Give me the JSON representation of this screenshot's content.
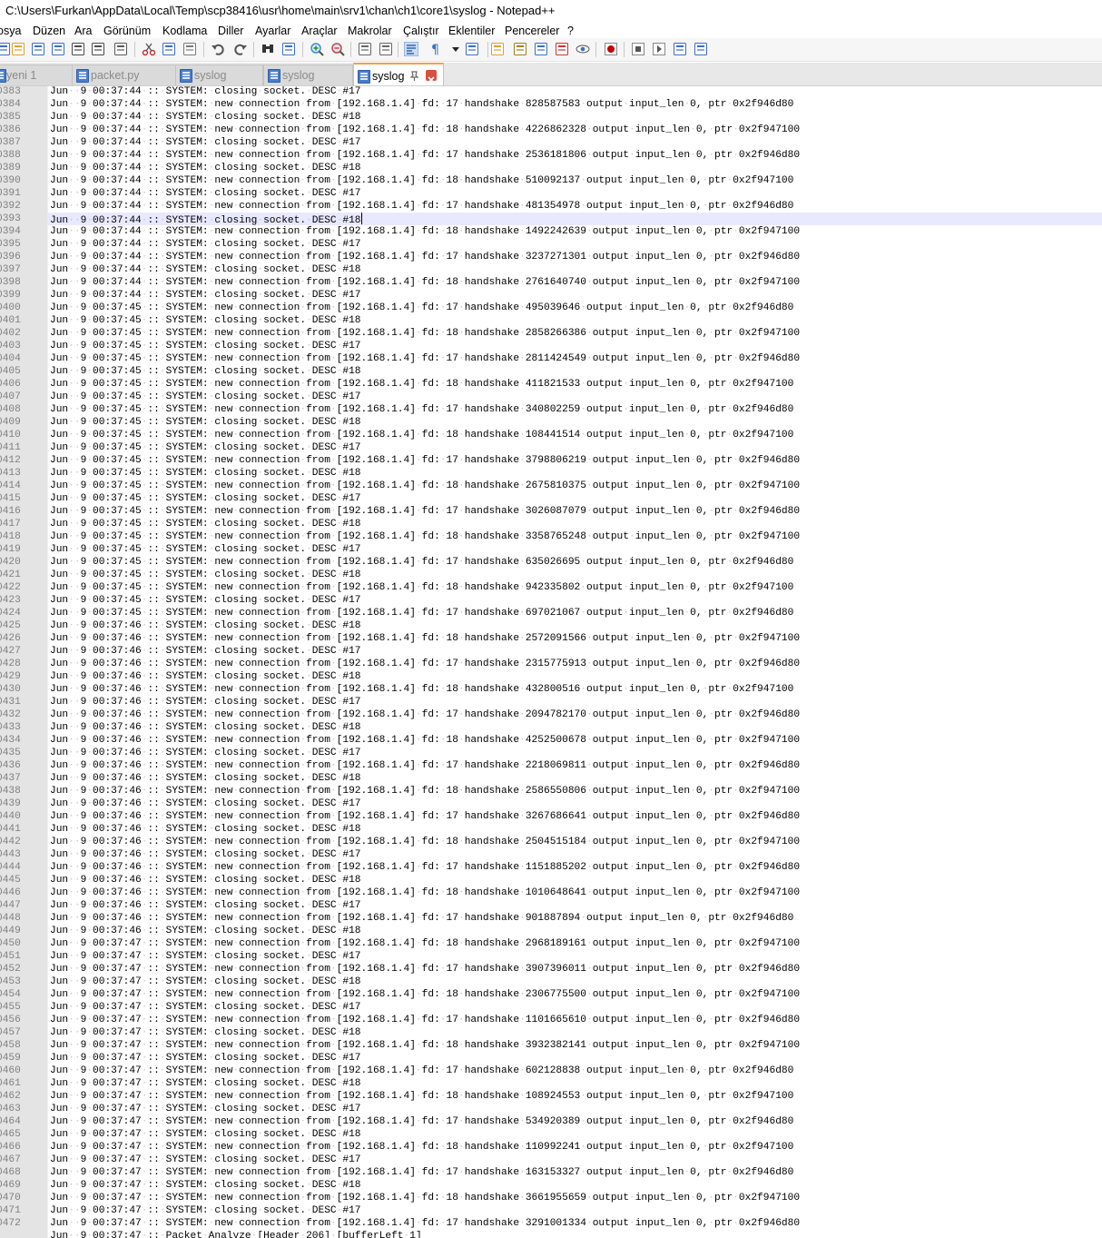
{
  "window": {
    "title": "C:\\Users\\Furkan\\AppData\\Local\\Temp\\scp38416\\usr\\home\\main\\srv1\\chan\\ch1\\core1\\syslog - Notepad++"
  },
  "menu": [
    "osya",
    "Düzen",
    "Ara",
    "Görünüm",
    "Kodlama",
    "Diller",
    "Ayarlar",
    "Araçlar",
    "Makrolar",
    "Çalıştır",
    "Eklentiler",
    "Pencereler",
    "?"
  ],
  "tabs": [
    {
      "label": "yeni 1",
      "active": false
    },
    {
      "label": "packet.py",
      "active": false
    },
    {
      "label": "syslog",
      "active": false
    },
    {
      "label": "syslog",
      "active": false
    },
    {
      "label": "syslog",
      "active": true
    }
  ],
  "editor": {
    "current_line": 393,
    "last_partial_line": "Jun  9 00:37:47 :: Packet Analyze [Header 206] [bufferLeft 1]",
    "lines": [
      {
        "n": "0383",
        "t": "Jun  9 00:37:44 :: SYSTEM: closing socket. DESC #17"
      },
      {
        "n": "0384",
        "t": "Jun  9 00:37:44 :: SYSTEM: new connection from [192.168.1.4] fd: 17 handshake 828587583 output input_len 0, ptr 0x2f946d80"
      },
      {
        "n": "0385",
        "t": "Jun  9 00:37:44 :: SYSTEM: closing socket. DESC #18"
      },
      {
        "n": "0386",
        "t": "Jun  9 00:37:44 :: SYSTEM: new connection from [192.168.1.4] fd: 18 handshake 4226862328 output input_len 0, ptr 0x2f947100"
      },
      {
        "n": "0387",
        "t": "Jun  9 00:37:44 :: SYSTEM: closing socket. DESC #17"
      },
      {
        "n": "0388",
        "t": "Jun  9 00:37:44 :: SYSTEM: new connection from [192.168.1.4] fd: 17 handshake 2536181806 output input_len 0, ptr 0x2f946d80"
      },
      {
        "n": "0389",
        "t": "Jun  9 00:37:44 :: SYSTEM: closing socket. DESC #18"
      },
      {
        "n": "0390",
        "t": "Jun  9 00:37:44 :: SYSTEM: new connection from [192.168.1.4] fd: 18 handshake 510092137 output input_len 0, ptr 0x2f947100"
      },
      {
        "n": "0391",
        "t": "Jun  9 00:37:44 :: SYSTEM: closing socket. DESC #17"
      },
      {
        "n": "0392",
        "t": "Jun  9 00:37:44 :: SYSTEM: new connection from [192.168.1.4] fd: 17 handshake 481354978 output input_len 0, ptr 0x2f946d80"
      },
      {
        "n": "0393",
        "t": "Jun  9 00:37:44 :: SYSTEM: closing socket. DESC #18"
      },
      {
        "n": "0394",
        "t": "Jun  9 00:37:44 :: SYSTEM: new connection from [192.168.1.4] fd: 18 handshake 1492242639 output input_len 0, ptr 0x2f947100"
      },
      {
        "n": "0395",
        "t": "Jun  9 00:37:44 :: SYSTEM: closing socket. DESC #17"
      },
      {
        "n": "0396",
        "t": "Jun  9 00:37:44 :: SYSTEM: new connection from [192.168.1.4] fd: 17 handshake 3237271301 output input_len 0, ptr 0x2f946d80"
      },
      {
        "n": "0397",
        "t": "Jun  9 00:37:44 :: SYSTEM: closing socket. DESC #18"
      },
      {
        "n": "0398",
        "t": "Jun  9 00:37:44 :: SYSTEM: new connection from [192.168.1.4] fd: 18 handshake 2761640740 output input_len 0, ptr 0x2f947100"
      },
      {
        "n": "0399",
        "t": "Jun  9 00:37:44 :: SYSTEM: closing socket. DESC #17"
      },
      {
        "n": "0400",
        "t": "Jun  9 00:37:45 :: SYSTEM: new connection from [192.168.1.4] fd: 17 handshake 495039646 output input_len 0, ptr 0x2f946d80"
      },
      {
        "n": "0401",
        "t": "Jun  9 00:37:45 :: SYSTEM: closing socket. DESC #18"
      },
      {
        "n": "0402",
        "t": "Jun  9 00:37:45 :: SYSTEM: new connection from [192.168.1.4] fd: 18 handshake 2858266386 output input_len 0, ptr 0x2f947100"
      },
      {
        "n": "0403",
        "t": "Jun  9 00:37:45 :: SYSTEM: closing socket. DESC #17"
      },
      {
        "n": "0404",
        "t": "Jun  9 00:37:45 :: SYSTEM: new connection from [192.168.1.4] fd: 17 handshake 2811424549 output input_len 0, ptr 0x2f946d80"
      },
      {
        "n": "0405",
        "t": "Jun  9 00:37:45 :: SYSTEM: closing socket. DESC #18"
      },
      {
        "n": "0406",
        "t": "Jun  9 00:37:45 :: SYSTEM: new connection from [192.168.1.4] fd: 18 handshake 411821533 output input_len 0, ptr 0x2f947100"
      },
      {
        "n": "0407",
        "t": "Jun  9 00:37:45 :: SYSTEM: closing socket. DESC #17"
      },
      {
        "n": "0408",
        "t": "Jun  9 00:37:45 :: SYSTEM: new connection from [192.168.1.4] fd: 17 handshake 340802259 output input_len 0, ptr 0x2f946d80"
      },
      {
        "n": "0409",
        "t": "Jun  9 00:37:45 :: SYSTEM: closing socket. DESC #18"
      },
      {
        "n": "0410",
        "t": "Jun  9 00:37:45 :: SYSTEM: new connection from [192.168.1.4] fd: 18 handshake 108441514 output input_len 0, ptr 0x2f947100"
      },
      {
        "n": "0411",
        "t": "Jun  9 00:37:45 :: SYSTEM: closing socket. DESC #17"
      },
      {
        "n": "0412",
        "t": "Jun  9 00:37:45 :: SYSTEM: new connection from [192.168.1.4] fd: 17 handshake 3798806219 output input_len 0, ptr 0x2f946d80"
      },
      {
        "n": "0413",
        "t": "Jun  9 00:37:45 :: SYSTEM: closing socket. DESC #18"
      },
      {
        "n": "0414",
        "t": "Jun  9 00:37:45 :: SYSTEM: new connection from [192.168.1.4] fd: 18 handshake 2675810375 output input_len 0, ptr 0x2f947100"
      },
      {
        "n": "0415",
        "t": "Jun  9 00:37:45 :: SYSTEM: closing socket. DESC #17"
      },
      {
        "n": "0416",
        "t": "Jun  9 00:37:45 :: SYSTEM: new connection from [192.168.1.4] fd: 17 handshake 3026087079 output input_len 0, ptr 0x2f946d80"
      },
      {
        "n": "0417",
        "t": "Jun  9 00:37:45 :: SYSTEM: closing socket. DESC #18"
      },
      {
        "n": "0418",
        "t": "Jun  9 00:37:45 :: SYSTEM: new connection from [192.168.1.4] fd: 18 handshake 3358765248 output input_len 0, ptr 0x2f947100"
      },
      {
        "n": "0419",
        "t": "Jun  9 00:37:45 :: SYSTEM: closing socket. DESC #17"
      },
      {
        "n": "0420",
        "t": "Jun  9 00:37:45 :: SYSTEM: new connection from [192.168.1.4] fd: 17 handshake 635026695 output input_len 0, ptr 0x2f946d80"
      },
      {
        "n": "0421",
        "t": "Jun  9 00:37:45 :: SYSTEM: closing socket. DESC #18"
      },
      {
        "n": "0422",
        "t": "Jun  9 00:37:45 :: SYSTEM: new connection from [192.168.1.4] fd: 18 handshake 942335802 output input_len 0, ptr 0x2f947100"
      },
      {
        "n": "0423",
        "t": "Jun  9 00:37:45 :: SYSTEM: closing socket. DESC #17"
      },
      {
        "n": "0424",
        "t": "Jun  9 00:37:45 :: SYSTEM: new connection from [192.168.1.4] fd: 17 handshake 697021067 output input_len 0, ptr 0x2f946d80"
      },
      {
        "n": "0425",
        "t": "Jun  9 00:37:46 :: SYSTEM: closing socket. DESC #18"
      },
      {
        "n": "0426",
        "t": "Jun  9 00:37:46 :: SYSTEM: new connection from [192.168.1.4] fd: 18 handshake 2572091566 output input_len 0, ptr 0x2f947100"
      },
      {
        "n": "0427",
        "t": "Jun  9 00:37:46 :: SYSTEM: closing socket. DESC #17"
      },
      {
        "n": "0428",
        "t": "Jun  9 00:37:46 :: SYSTEM: new connection from [192.168.1.4] fd: 17 handshake 2315775913 output input_len 0, ptr 0x2f946d80"
      },
      {
        "n": "0429",
        "t": "Jun  9 00:37:46 :: SYSTEM: closing socket. DESC #18"
      },
      {
        "n": "0430",
        "t": "Jun  9 00:37:46 :: SYSTEM: new connection from [192.168.1.4] fd: 18 handshake 432800516 output input_len 0, ptr 0x2f947100"
      },
      {
        "n": "0431",
        "t": "Jun  9 00:37:46 :: SYSTEM: closing socket. DESC #17"
      },
      {
        "n": "0432",
        "t": "Jun  9 00:37:46 :: SYSTEM: new connection from [192.168.1.4] fd: 17 handshake 2094782170 output input_len 0, ptr 0x2f946d80"
      },
      {
        "n": "0433",
        "t": "Jun  9 00:37:46 :: SYSTEM: closing socket. DESC #18"
      },
      {
        "n": "0434",
        "t": "Jun  9 00:37:46 :: SYSTEM: new connection from [192.168.1.4] fd: 18 handshake 4252500678 output input_len 0, ptr 0x2f947100"
      },
      {
        "n": "0435",
        "t": "Jun  9 00:37:46 :: SYSTEM: closing socket. DESC #17"
      },
      {
        "n": "0436",
        "t": "Jun  9 00:37:46 :: SYSTEM: new connection from [192.168.1.4] fd: 17 handshake 2218069811 output input_len 0, ptr 0x2f946d80"
      },
      {
        "n": "0437",
        "t": "Jun  9 00:37:46 :: SYSTEM: closing socket. DESC #18"
      },
      {
        "n": "0438",
        "t": "Jun  9 00:37:46 :: SYSTEM: new connection from [192.168.1.4] fd: 18 handshake 2586550806 output input_len 0, ptr 0x2f947100"
      },
      {
        "n": "0439",
        "t": "Jun  9 00:37:46 :: SYSTEM: closing socket. DESC #17"
      },
      {
        "n": "0440",
        "t": "Jun  9 00:37:46 :: SYSTEM: new connection from [192.168.1.4] fd: 17 handshake 3267686641 output input_len 0, ptr 0x2f946d80"
      },
      {
        "n": "0441",
        "t": "Jun  9 00:37:46 :: SYSTEM: closing socket. DESC #18"
      },
      {
        "n": "0442",
        "t": "Jun  9 00:37:46 :: SYSTEM: new connection from [192.168.1.4] fd: 18 handshake 2504515184 output input_len 0, ptr 0x2f947100"
      },
      {
        "n": "0443",
        "t": "Jun  9 00:37:46 :: SYSTEM: closing socket. DESC #17"
      },
      {
        "n": "0444",
        "t": "Jun  9 00:37:46 :: SYSTEM: new connection from [192.168.1.4] fd: 17 handshake 1151885202 output input_len 0, ptr 0x2f946d80"
      },
      {
        "n": "0445",
        "t": "Jun  9 00:37:46 :: SYSTEM: closing socket. DESC #18"
      },
      {
        "n": "0446",
        "t": "Jun  9 00:37:46 :: SYSTEM: new connection from [192.168.1.4] fd: 18 handshake 1010648641 output input_len 0, ptr 0x2f947100"
      },
      {
        "n": "0447",
        "t": "Jun  9 00:37:46 :: SYSTEM: closing socket. DESC #17"
      },
      {
        "n": "0448",
        "t": "Jun  9 00:37:46 :: SYSTEM: new connection from [192.168.1.4] fd: 17 handshake 901887894 output input_len 0, ptr 0x2f946d80"
      },
      {
        "n": "0449",
        "t": "Jun  9 00:37:46 :: SYSTEM: closing socket. DESC #18"
      },
      {
        "n": "0450",
        "t": "Jun  9 00:37:47 :: SYSTEM: new connection from [192.168.1.4] fd: 18 handshake 2968189161 output input_len 0, ptr 0x2f947100"
      },
      {
        "n": "0451",
        "t": "Jun  9 00:37:47 :: SYSTEM: closing socket. DESC #17"
      },
      {
        "n": "0452",
        "t": "Jun  9 00:37:47 :: SYSTEM: new connection from [192.168.1.4] fd: 17 handshake 3907396011 output input_len 0, ptr 0x2f946d80"
      },
      {
        "n": "0453",
        "t": "Jun  9 00:37:47 :: SYSTEM: closing socket. DESC #18"
      },
      {
        "n": "0454",
        "t": "Jun  9 00:37:47 :: SYSTEM: new connection from [192.168.1.4] fd: 18 handshake 2306775500 output input_len 0, ptr 0x2f947100"
      },
      {
        "n": "0455",
        "t": "Jun  9 00:37:47 :: SYSTEM: closing socket. DESC #17"
      },
      {
        "n": "0456",
        "t": "Jun  9 00:37:47 :: SYSTEM: new connection from [192.168.1.4] fd: 17 handshake 1101665610 output input_len 0, ptr 0x2f946d80"
      },
      {
        "n": "0457",
        "t": "Jun  9 00:37:47 :: SYSTEM: closing socket. DESC #18"
      },
      {
        "n": "0458",
        "t": "Jun  9 00:37:47 :: SYSTEM: new connection from [192.168.1.4] fd: 18 handshake 3932382141 output input_len 0, ptr 0x2f947100"
      },
      {
        "n": "0459",
        "t": "Jun  9 00:37:47 :: SYSTEM: closing socket. DESC #17"
      },
      {
        "n": "0460",
        "t": "Jun  9 00:37:47 :: SYSTEM: new connection from [192.168.1.4] fd: 17 handshake 602128838 output input_len 0, ptr 0x2f946d80"
      },
      {
        "n": "0461",
        "t": "Jun  9 00:37:47 :: SYSTEM: closing socket. DESC #18"
      },
      {
        "n": "0462",
        "t": "Jun  9 00:37:47 :: SYSTEM: new connection from [192.168.1.4] fd: 18 handshake 108924553 output input_len 0, ptr 0x2f947100"
      },
      {
        "n": "0463",
        "t": "Jun  9 00:37:47 :: SYSTEM: closing socket. DESC #17"
      },
      {
        "n": "0464",
        "t": "Jun  9 00:37:47 :: SYSTEM: new connection from [192.168.1.4] fd: 17 handshake 534920389 output input_len 0, ptr 0x2f946d80"
      },
      {
        "n": "0465",
        "t": "Jun  9 00:37:47 :: SYSTEM: closing socket. DESC #18"
      },
      {
        "n": "0466",
        "t": "Jun  9 00:37:47 :: SYSTEM: new connection from [192.168.1.4] fd: 18 handshake 110992241 output input_len 0, ptr 0x2f947100"
      },
      {
        "n": "0467",
        "t": "Jun  9 00:37:47 :: SYSTEM: closing socket. DESC #17"
      },
      {
        "n": "0468",
        "t": "Jun  9 00:37:47 :: SYSTEM: new connection from [192.168.1.4] fd: 17 handshake 163153327 output input_len 0, ptr 0x2f946d80"
      },
      {
        "n": "0469",
        "t": "Jun  9 00:37:47 :: SYSTEM: closing socket. DESC #18"
      },
      {
        "n": "0470",
        "t": "Jun  9 00:37:47 :: SYSTEM: new connection from [192.168.1.4] fd: 18 handshake 3661955659 output input_len 0, ptr 0x2f947100"
      },
      {
        "n": "0471",
        "t": "Jun  9 00:37:47 :: SYSTEM: closing socket. DESC #17"
      },
      {
        "n": "0472",
        "t": "Jun  9 00:37:47 :: SYSTEM: new connection from [192.168.1.4] fd: 17 handshake 3291001334 output input_len 0, ptr 0x2f946d80"
      }
    ]
  },
  "icons": [
    "new-file-icon",
    "open-file-icon",
    "save-icon",
    "save-all-icon",
    "close-icon",
    "close-all-icon",
    "print-icon",
    "cut-icon",
    "copy-icon",
    "paste-icon",
    "undo-icon",
    "redo-icon",
    "find-icon",
    "replace-icon",
    "zoom-in-icon",
    "zoom-out-icon",
    "sync-v-icon",
    "sync-h-icon",
    "wrap-icon",
    "show-all-chars-icon",
    "dropdown-icon",
    "indent-guide-icon",
    "udl-icon",
    "map-icon",
    "function-list-icon",
    "folder-workspace-icon",
    "monitor-icon",
    "record-macro-icon",
    "stop-macro-icon",
    "play-macro-icon",
    "run-macro-multi-icon",
    "save-macro-icon"
  ]
}
